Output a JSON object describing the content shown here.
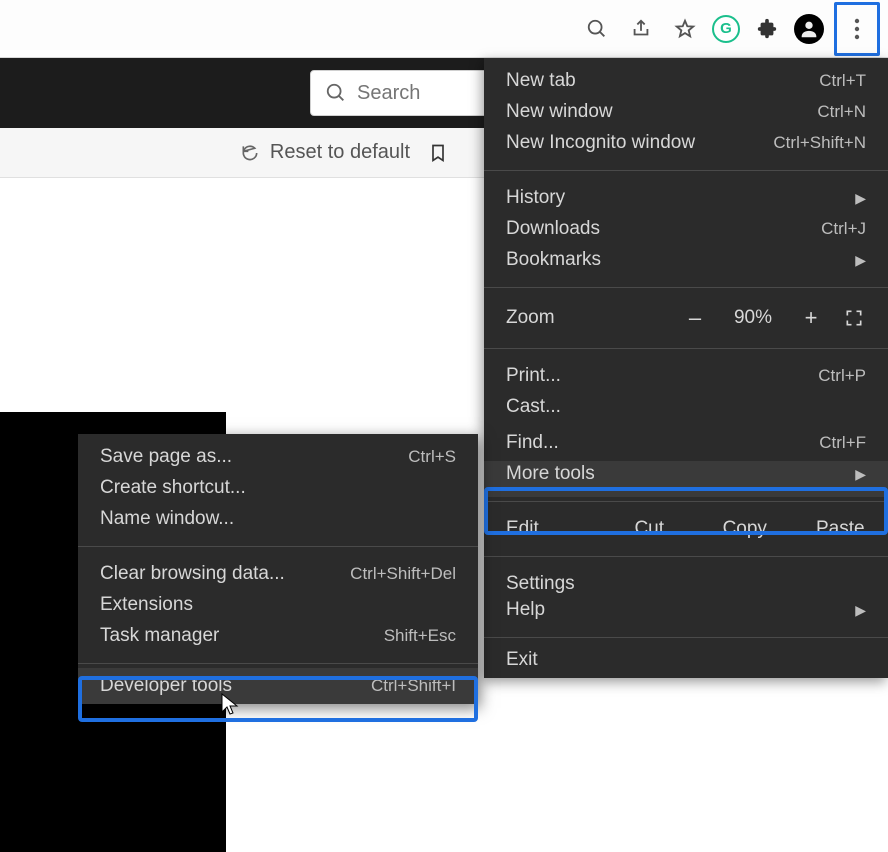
{
  "toolbar": {
    "grammarly_letter": "G"
  },
  "page": {
    "search_placeholder": "Search",
    "reset_label": "Reset to default"
  },
  "menu": {
    "new_tab": "New tab",
    "new_tab_short": "Ctrl+T",
    "new_window": "New window",
    "new_window_short": "Ctrl+N",
    "new_incog": "New Incognito window",
    "new_incog_short": "Ctrl+Shift+N",
    "history": "History",
    "downloads": "Downloads",
    "downloads_short": "Ctrl+J",
    "bookmarks": "Bookmarks",
    "zoom_label": "Zoom",
    "zoom_minus": "–",
    "zoom_pct": "90%",
    "zoom_plus": "+",
    "print": "Print...",
    "print_short": "Ctrl+P",
    "cast": "Cast...",
    "find": "Find...",
    "find_short": "Ctrl+F",
    "more_tools": "More tools",
    "edit": "Edit",
    "cut": "Cut",
    "copy": "Copy",
    "paste": "Paste",
    "settings": "Settings",
    "help": "Help",
    "exit": "Exit"
  },
  "submenu": {
    "save_as": "Save page as...",
    "save_as_short": "Ctrl+S",
    "create_shortcut": "Create shortcut...",
    "name_window": "Name window...",
    "clear_data": "Clear browsing data...",
    "clear_data_short": "Ctrl+Shift+Del",
    "extensions": "Extensions",
    "task_manager": "Task manager",
    "task_manager_short": "Shift+Esc",
    "dev_tools": "Developer tools",
    "dev_tools_short": "Ctrl+Shift+I"
  }
}
